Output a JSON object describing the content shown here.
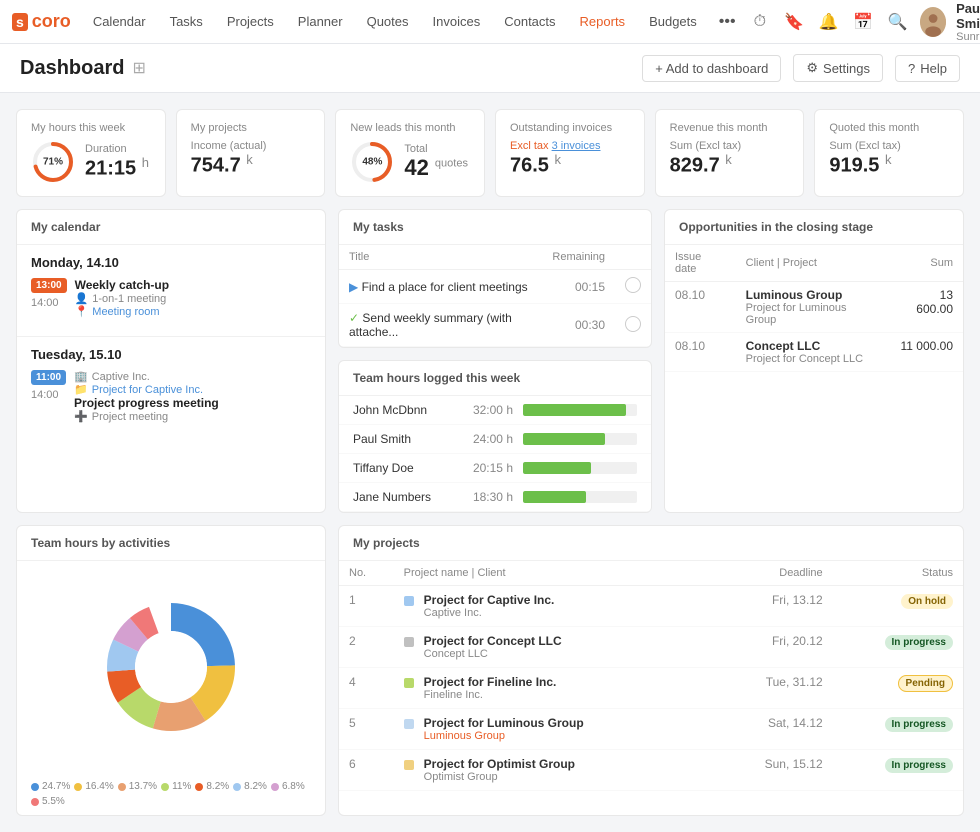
{
  "nav": {
    "logo": "scoro",
    "items": [
      "Calendar",
      "Tasks",
      "Projects",
      "Planner",
      "Quotes",
      "Invoices",
      "Contacts",
      "Reports",
      "Budgets"
    ],
    "active": "Reports",
    "user": {
      "name": "Paul Smith",
      "company": "Sunrise Ltd"
    }
  },
  "page": {
    "title": "Dashboard",
    "actions": {
      "add": "+ Add to dashboard",
      "settings": "Settings",
      "help": "Help"
    }
  },
  "stats": [
    {
      "label": "My hours this week",
      "percent": 71,
      "sub_label": "Duration",
      "value": "21:15",
      "unit": "h",
      "color": "#e85d26"
    },
    {
      "label": "My projects",
      "sub_label": "Income (actual)",
      "value": "754.7",
      "unit": "k",
      "color": "#6cbf4a"
    },
    {
      "label": "New leads this month",
      "percent": 48,
      "sub_label": "Total",
      "value": "42",
      "unit": "quotes",
      "color": "#e85d26"
    },
    {
      "label": "Outstanding invoices",
      "sub_label": "Excl tax 3 invoices",
      "value": "76.5",
      "unit": "k",
      "color": "#4a90d9"
    },
    {
      "label": "Revenue this month",
      "sub_label": "Sum (Excl tax)",
      "value": "829.7",
      "unit": "k",
      "color": "#4a90d9"
    },
    {
      "label": "Quoted this month",
      "sub_label": "Sum (Excl tax)",
      "value": "919.5",
      "unit": "k",
      "color": "#4a90d9"
    }
  ],
  "calendar": {
    "header": "My calendar",
    "days": [
      {
        "title": "Monday, 14.10",
        "events": [
          {
            "start": "13:00",
            "end": "14:00",
            "badge_color": "#e85d26",
            "badge_text": "13:00",
            "title": "Weekly catch-up",
            "meta1": "1-on-1 meeting",
            "meta2": "Meeting room"
          }
        ]
      },
      {
        "title": "Tuesday, 15.10",
        "events": [
          {
            "start": "11:00",
            "end": "14:00",
            "badge_color": "#4a90d9",
            "badge_text": "11:00",
            "title": "Project progress meeting",
            "meta1": "Captive Inc.",
            "meta2": "Project for Captive Inc.",
            "meta3": "Project meeting"
          }
        ]
      }
    ]
  },
  "tasks": {
    "header": "My tasks",
    "columns": [
      "Title",
      "",
      "Remaining",
      ""
    ],
    "rows": [
      {
        "icon": "triangle",
        "color": "blue",
        "title": "Find a place for client meetings",
        "remaining": "00:15"
      },
      {
        "icon": "check",
        "color": "green",
        "title": "Send weekly summary (with attache...",
        "remaining": "00:30"
      }
    ]
  },
  "team_hours": {
    "header": "Team hours logged this week",
    "rows": [
      {
        "name": "John McDbnn",
        "hours": "32:00 h",
        "bar": 90
      },
      {
        "name": "Paul Smith",
        "hours": "24:00 h",
        "bar": 72
      },
      {
        "name": "Tiffany Doe",
        "hours": "20:15 h",
        "bar": 60
      },
      {
        "name": "Jane Numbers",
        "hours": "18:30 h",
        "bar": 55
      }
    ]
  },
  "opportunities": {
    "header": "Opportunities in the closing stage",
    "columns": [
      "Issue date",
      "Client | Project",
      "Sum"
    ],
    "rows": [
      {
        "date": "08.10",
        "client": "Luminous Group",
        "project": "Project for Luminous Group",
        "sum": "13 600.00"
      },
      {
        "date": "08.10",
        "client": "Concept LLC",
        "project": "Project for Concept LLC",
        "sum": "11 000.00"
      }
    ]
  },
  "team_activities": {
    "header": "Team hours by activities",
    "segments": [
      {
        "label": "24.7%",
        "color": "#4a90d9",
        "value": 24.7
      },
      {
        "label": "16.4%",
        "color": "#f0c040",
        "value": 16.4
      },
      {
        "label": "13.7%",
        "color": "#e8a070",
        "value": 13.7
      },
      {
        "label": "11%",
        "color": "#b8d96a",
        "value": 11
      },
      {
        "label": "8.2%",
        "color": "#e85d26",
        "value": 8.2
      },
      {
        "label": "8.2%",
        "color": "#a0c8f0",
        "value": 8.2
      },
      {
        "label": "6.8%",
        "color": "#d4a0d0",
        "value": 6.8
      },
      {
        "label": "5.5%",
        "color": "#f07878",
        "value": 5.5
      }
    ]
  },
  "projects": {
    "header": "My projects",
    "columns": [
      "No.",
      "Project name | Client",
      "",
      "Deadline",
      "Status"
    ],
    "rows": [
      {
        "no": 1,
        "color": "#a0c8f0",
        "name": "Project for Captive Inc.",
        "client": "Captive Inc.",
        "deadline": "Fri, 13.12",
        "status": "On hold",
        "status_class": "status-onhold"
      },
      {
        "no": 2,
        "color": "#c0c0c0",
        "name": "Project for Concept LLC",
        "client": "Concept LLC",
        "deadline": "Fri, 20.12",
        "status": "In progress",
        "status_class": "status-inprogress"
      },
      {
        "no": 4,
        "color": "#b8d96a",
        "name": "Project for Fineline Inc.",
        "client": "Fineline Inc.",
        "deadline": "Tue, 31.12",
        "status": "Pending",
        "status_class": "status-pending"
      },
      {
        "no": 5,
        "color": "#c0d8f0",
        "name": "Project for Luminous Group",
        "client": "Luminous Group",
        "deadline": "Sat, 14.12",
        "status": "In progress",
        "status_class": "status-inprogress"
      },
      {
        "no": 6,
        "color": "#f0d080",
        "name": "Project for Optimist Group",
        "client": "Optimist Group",
        "deadline": "Sun, 15.12",
        "status": "In progress",
        "status_class": "status-inprogress"
      }
    ]
  }
}
